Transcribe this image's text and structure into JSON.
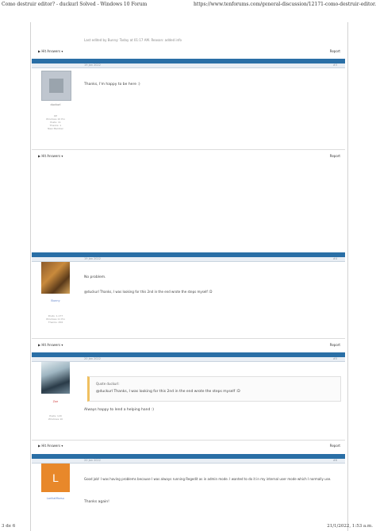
{
  "browser": {
    "page_title": "Como destruir editor? - duckurl Solved - Windows 10 Forum",
    "url": "https://www.tenforums.com/general-discussion/12171-como-destruir-editor.html"
  },
  "footer": {
    "page_num": "3 de 6",
    "date": "21/1/2022, 1:53 a.m."
  },
  "thread": {
    "top_meta": "Last edited by Bunny: Today at 01:17 AM. Reason: added info",
    "action_left": "▶ Hit Answers ▾",
    "action_right": "Report",
    "posts": [
      {
        "date": "19 Jan 2022",
        "num": "#3",
        "user": "duckurl",
        "meta": [
          "OP",
          "Windows 10 Pro",
          "Posts: 11",
          "Thanks: 1",
          "New Member"
        ],
        "message": "Thanks, I'm happy to be here :)"
      },
      {
        "date": "19 Jan 2022",
        "num": "#4",
        "user": "Bunny",
        "meta": [
          "Posts: 1,177",
          "Windows 11 Pro",
          "Thanks: 456"
        ],
        "message": "No problem.",
        "quote": "@duckurl Thanks, I was looking for this 2nd in the end wrote the steps myself :D"
      },
      {
        "date": "20 Jan 2022",
        "num": "#5",
        "user": "Zoe",
        "meta": [
          "Posts: 120",
          "Windows 10"
        ],
        "quote_header": "Quote duckurl:",
        "quote": "@duckurl Thanks, I was looking for this 2nd in the end wrote the steps myself :D",
        "message": "Always happy to lend a helping hand :)"
      },
      {
        "date": "20 Jan 2022",
        "num": "#6",
        "user": "LoriliaIMorsu",
        "avatar_letter": "L",
        "message": "Good job! I was having problems because I was always running Regedit as in admin mode. I wanted to do it in my internal user mode which I normally use.",
        "message2": "Thanks again!"
      }
    ]
  }
}
